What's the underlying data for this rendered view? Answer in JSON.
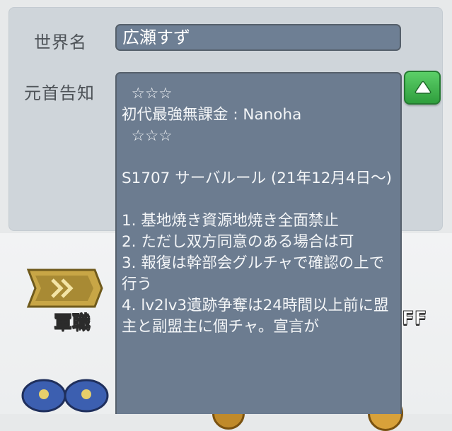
{
  "labels": {
    "world_name": "世界名",
    "head_notice": "元首告知"
  },
  "world_name_value": "広瀬すず",
  "notice_text": "  ☆☆☆\n初代最強無課金 : Nanoha\n  ☆☆☆\n\nS1707 サーバルール (21年12月4日〜)\n\n1. 基地焼き資源地焼き全面禁止\n2. ただし双方同意のある場合は可\n3. 報復は幹部会グルチャで確認の上で行う\n4. lv2lv3遺跡争奪は24時間以上前に盟主と副盟主に個チャ。宣言が",
  "background": {
    "rank_label": "軍職",
    "buff_label": "FF",
    "ghost_under_text": "1707 サーバルール (21年12月",
    "ghost_tail": "a"
  },
  "icons": {
    "collapse": "chevron-up-icon",
    "rank": "rank-chevron-icon",
    "caps": "officer-cap-icon"
  },
  "colors": {
    "panel": "#cfd5da",
    "field": "#6e7f94",
    "button": "#3fb64f"
  }
}
